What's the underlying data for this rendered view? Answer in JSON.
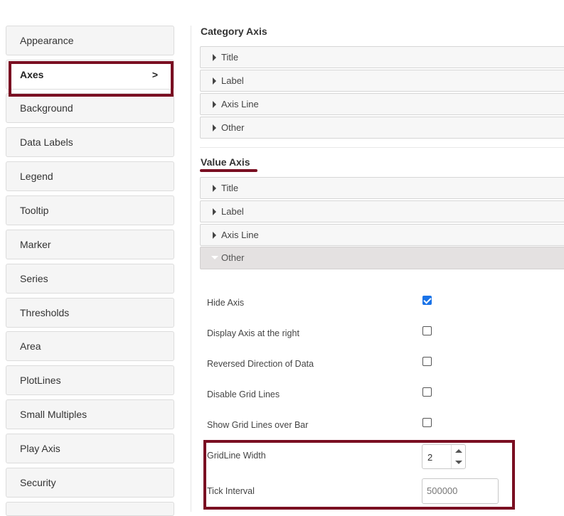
{
  "sidebar": {
    "items": [
      {
        "label": "Appearance"
      },
      {
        "label": "Axes",
        "chevron": ">",
        "active": true
      },
      {
        "label": "Background"
      },
      {
        "label": "Data Labels"
      },
      {
        "label": "Legend"
      },
      {
        "label": "Tooltip"
      },
      {
        "label": "Marker"
      },
      {
        "label": "Series"
      },
      {
        "label": "Thresholds"
      },
      {
        "label": "Area"
      },
      {
        "label": "PlotLines"
      },
      {
        "label": "Small Multiples"
      },
      {
        "label": "Play Axis"
      },
      {
        "label": "Security"
      }
    ]
  },
  "category_axis": {
    "title": "Category Axis",
    "sections": [
      "Title",
      "Label",
      "Axis Line",
      "Other"
    ]
  },
  "value_axis": {
    "title": "Value Axis",
    "sections": [
      "Title",
      "Label",
      "Axis Line",
      "Other"
    ],
    "open_section": "Other",
    "options": [
      {
        "label": "Hide Axis",
        "checked": true
      },
      {
        "label": "Display Axis at the right",
        "checked": false
      },
      {
        "label": "Reversed Direction of Data",
        "checked": false
      },
      {
        "label": "Disable Grid Lines",
        "checked": false
      },
      {
        "label": "Show Grid Lines over Bar",
        "checked": false
      }
    ],
    "gridline_width": {
      "label": "GridLine Width",
      "value": "2"
    },
    "tick_interval": {
      "label": "Tick Interval",
      "placeholder": "500000"
    }
  },
  "colors": {
    "highlight": "#7a0f22",
    "checkbox_checked": "#1a73e8"
  }
}
